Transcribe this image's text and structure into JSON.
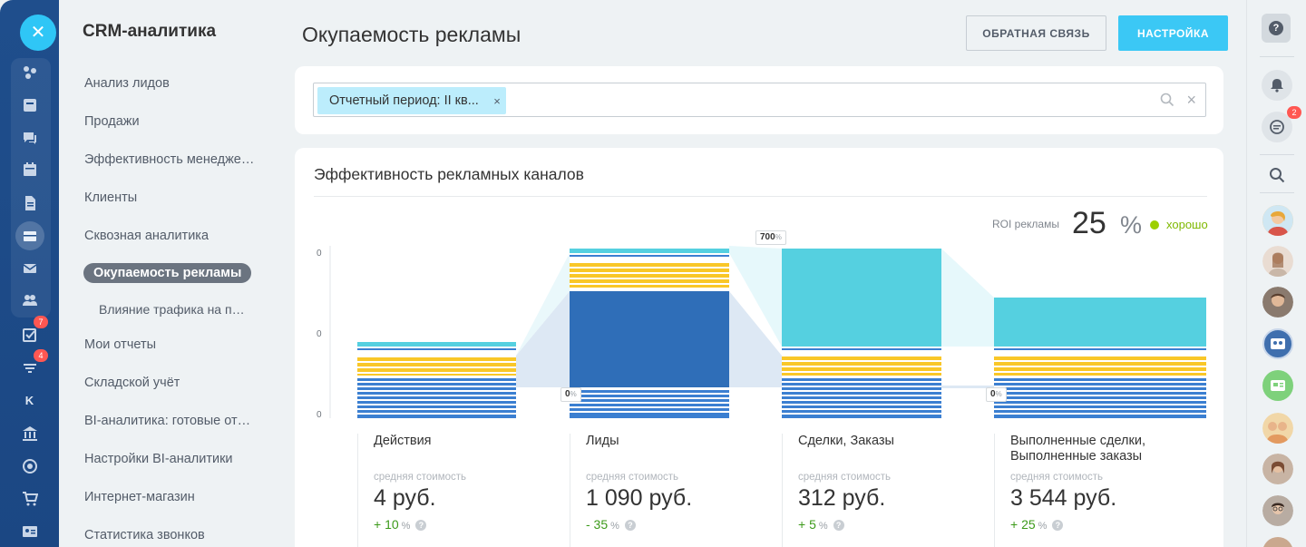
{
  "menu": {
    "title": "CRM-аналитика",
    "items": [
      "Анализ лидов",
      "Продажи",
      "Эффективность менеджеров",
      "Клиенты",
      "Сквозная аналитика",
      "Окупаемость рекламы",
      "Влияние трафика на продажи",
      "Мои отчеты",
      "Складской учёт",
      "BI-аналитика: готовые отчеты",
      "Настройки BI-аналитики",
      "Интернет-магазин",
      "Статистика звонков"
    ],
    "active_index": 5
  },
  "rail": {
    "badges": {
      "tasks": "7",
      "funnel": "4"
    },
    "letter": "K"
  },
  "header": {
    "title": "Окупаемость рекламы",
    "feedback_button": "ОБРАТНАЯ СВЯЗЬ",
    "settings_button": "НАСТРОЙКА"
  },
  "filter": {
    "chip": "Отчетный период: II кв...",
    "chip_remove": "×",
    "clear": "×"
  },
  "card": {
    "title": "Эффективность рекламных каналов",
    "roi_label": "ROI рекламы",
    "roi_value": "25",
    "roi_unit": "%",
    "roi_status": "хорошо"
  },
  "colors": {
    "accent": "#3bc8f5",
    "dark_blue": "#2f6eb8",
    "mid_blue": "#3b7fd1",
    "yellow": "#f9c728",
    "cyan": "#55d0e0",
    "good": "#9dcf00"
  },
  "chart_data": {
    "type": "bar",
    "y_ticks": [
      "0",
      "0",
      "0"
    ],
    "categories": [
      "Действия",
      "Лиды",
      "Сделки, Заказы",
      "Выполненные сделки, Выполненные заказы"
    ],
    "conversion_markers": [
      {
        "between": [
          0,
          1
        ],
        "value": "0",
        "unit": "%"
      },
      {
        "between": [
          1,
          2
        ],
        "value": "700",
        "unit": "%"
      },
      {
        "between": [
          2,
          3
        ],
        "value": "0",
        "unit": "%"
      }
    ],
    "stats": [
      {
        "label": "средняя стоимость",
        "cost": "4 руб.",
        "delta": "+ 10",
        "delta_unit": "%"
      },
      {
        "label": "средняя стоимость",
        "cost": "1 090 руб.",
        "delta": "- 35",
        "delta_unit": "%"
      },
      {
        "label": "средняя стоимость",
        "cost": "312 руб.",
        "delta": "+ 5",
        "delta_unit": "%"
      },
      {
        "label": "средняя стоимость",
        "cost": "3 544 руб.",
        "delta": "+ 25",
        "delta_unit": "%"
      }
    ],
    "grid": false,
    "legend": "none"
  },
  "right_rail": {
    "help": "?",
    "chat_badge": "2"
  }
}
